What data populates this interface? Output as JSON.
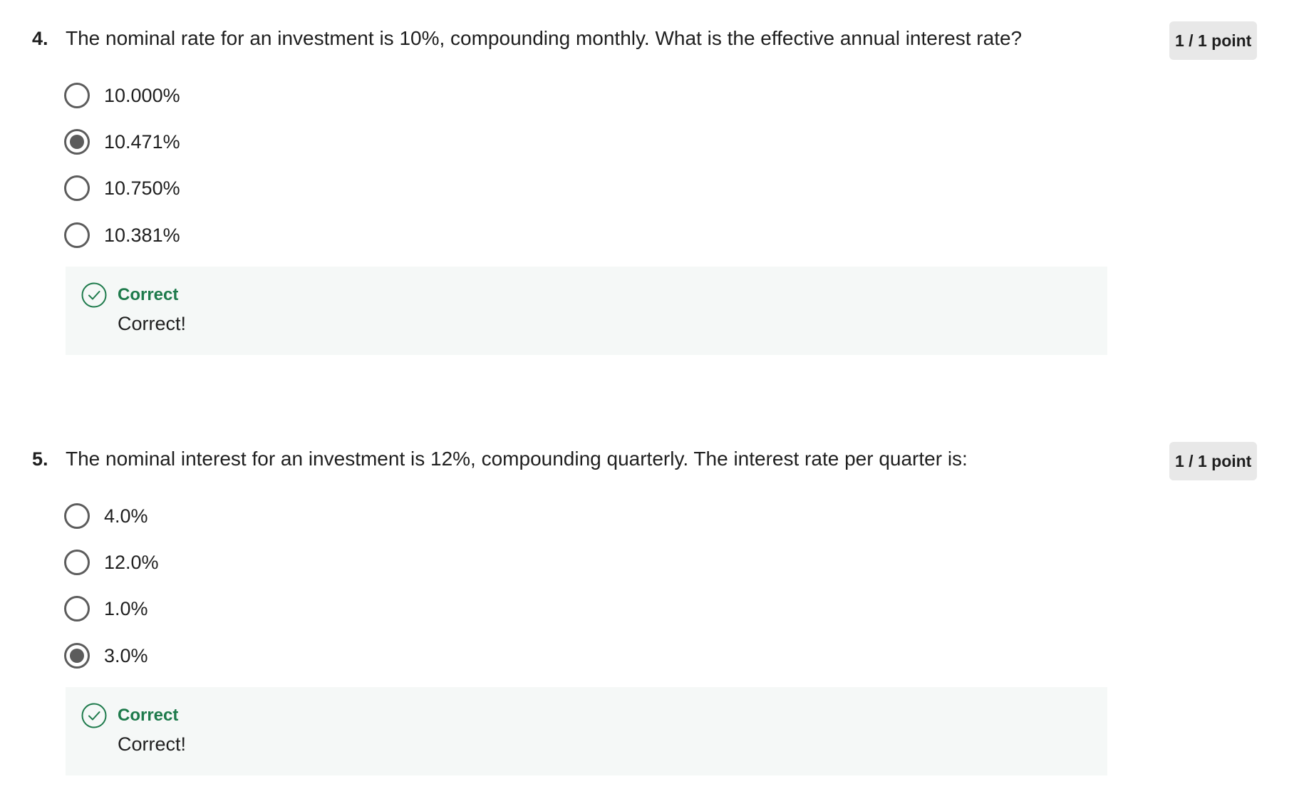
{
  "questions": [
    {
      "number": "4.",
      "text": "The nominal rate for an investment is 10%, compounding monthly. What is the effective annual interest rate?",
      "points": "1 / 1 point",
      "options": [
        {
          "label": "10.000%",
          "selected": false
        },
        {
          "label": "10.471%",
          "selected": true
        },
        {
          "label": "10.750%",
          "selected": false
        },
        {
          "label": "10.381%",
          "selected": false
        }
      ],
      "feedback": {
        "title": "Correct",
        "text": "Correct!",
        "icon": "check-circle-icon"
      }
    },
    {
      "number": "5.",
      "text": "The nominal interest for an investment is 12%, compounding quarterly. The interest rate per quarter is:",
      "points": "1 / 1 point",
      "options": [
        {
          "label": "4.0%",
          "selected": false
        },
        {
          "label": "12.0%",
          "selected": false
        },
        {
          "label": "1.0%",
          "selected": false
        },
        {
          "label": "3.0%",
          "selected": true
        }
      ],
      "feedback": {
        "title": "Correct",
        "text": "Correct!",
        "icon": "check-circle-icon"
      }
    }
  ],
  "colors": {
    "correct_green": "#1d7a4b",
    "feedback_bg": "#f5f8f7",
    "radio_gray": "#5c5c5c",
    "points_bg": "#e8e8e8"
  }
}
